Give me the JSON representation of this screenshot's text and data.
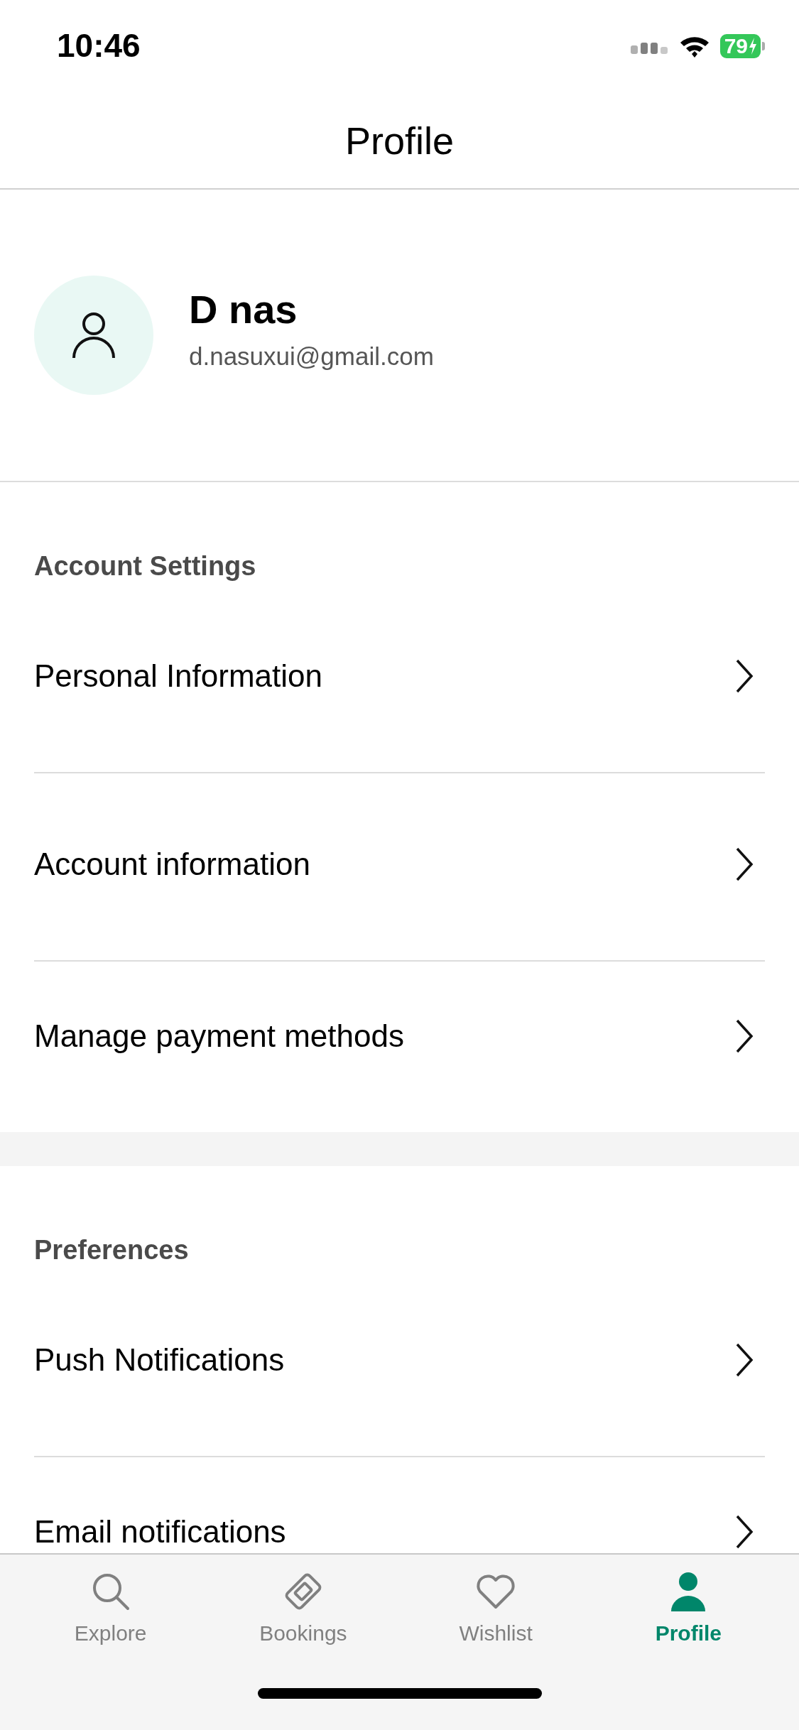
{
  "status_bar": {
    "time": "10:46",
    "battery": "79"
  },
  "header": {
    "title": "Profile"
  },
  "profile": {
    "name": "D nas",
    "email": "d.nasuxui@gmail.com"
  },
  "sections": [
    {
      "title": "Account Settings",
      "items": [
        {
          "label": "Personal Information"
        },
        {
          "label": "Account information"
        },
        {
          "label": "Manage payment methods"
        }
      ]
    },
    {
      "title": "Preferences",
      "items": [
        {
          "label": "Push Notifications"
        },
        {
          "label": "Email notifications"
        }
      ]
    }
  ],
  "tabs": [
    {
      "label": "Explore",
      "selected": false
    },
    {
      "label": "Bookings",
      "selected": false
    },
    {
      "label": "Wishlist",
      "selected": false
    },
    {
      "label": "Profile",
      "selected": true
    }
  ]
}
